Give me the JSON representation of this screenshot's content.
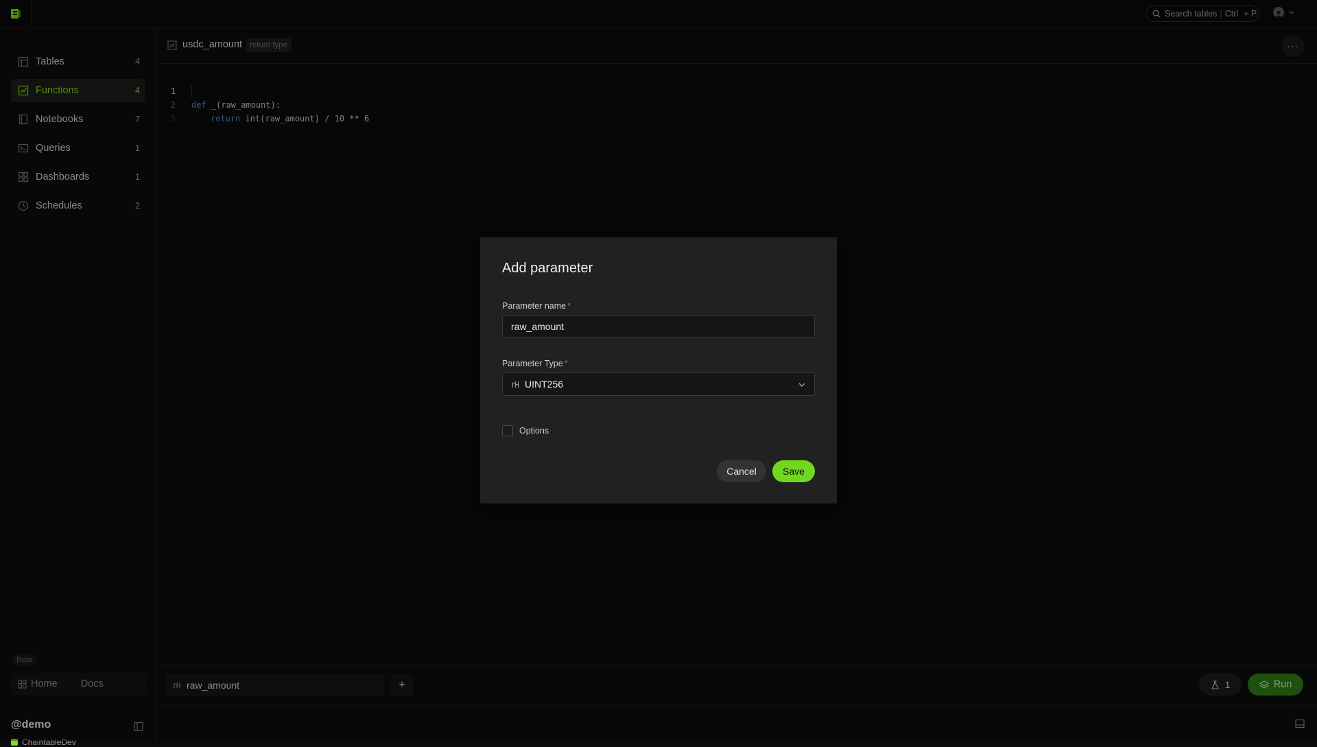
{
  "topbar": {
    "search_placeholder": "Search tables",
    "shortcut_key_1": "Ctrl",
    "shortcut_key_2": "+ P"
  },
  "sidebar": {
    "items": [
      {
        "label": "Tables",
        "count": "4",
        "icon": "table-icon"
      },
      {
        "label": "Functions",
        "count": "4",
        "icon": "function-icon",
        "active": true
      },
      {
        "label": "Notebooks",
        "count": "7",
        "icon": "notebook-icon"
      },
      {
        "label": "Queries",
        "count": "1",
        "icon": "terminal-icon"
      },
      {
        "label": "Dashboards",
        "count": "1",
        "icon": "dashboard-icon"
      },
      {
        "label": "Schedules",
        "count": "2",
        "icon": "clock-icon"
      }
    ],
    "beta_label": "Beta",
    "home_label": "Home",
    "docs_label": "Docs",
    "workspace": "@demo",
    "org": "ChaintableDev"
  },
  "header": {
    "function_name": "usdc_amount",
    "return_type_label": "return type",
    "more_label": "···"
  },
  "editor": {
    "line_numbers": [
      "1",
      "2",
      "3"
    ],
    "line1": {
      "kw": "def",
      "rest": " _(raw_amount):"
    },
    "line2": {
      "kw": "return",
      "rest": " int(raw_amount) / 10 ** 6"
    }
  },
  "params_bar": {
    "param_name": "raw_amount",
    "add_label": "+",
    "runs_count": "1",
    "run_label": "Run"
  },
  "modal": {
    "title": "Add parameter",
    "name_label": "Parameter name",
    "name_value": "raw_amount",
    "type_label": "Parameter Type",
    "type_value": "UINT256",
    "required_mark": "*",
    "options_label": "Options",
    "cancel_label": "Cancel",
    "save_label": "Save"
  },
  "colors": {
    "accent": "#7ddc1f",
    "save_button": "#70d81e",
    "run_button": "#2f7d17",
    "keyword": "#4f8ed8",
    "required": "#e05252"
  }
}
